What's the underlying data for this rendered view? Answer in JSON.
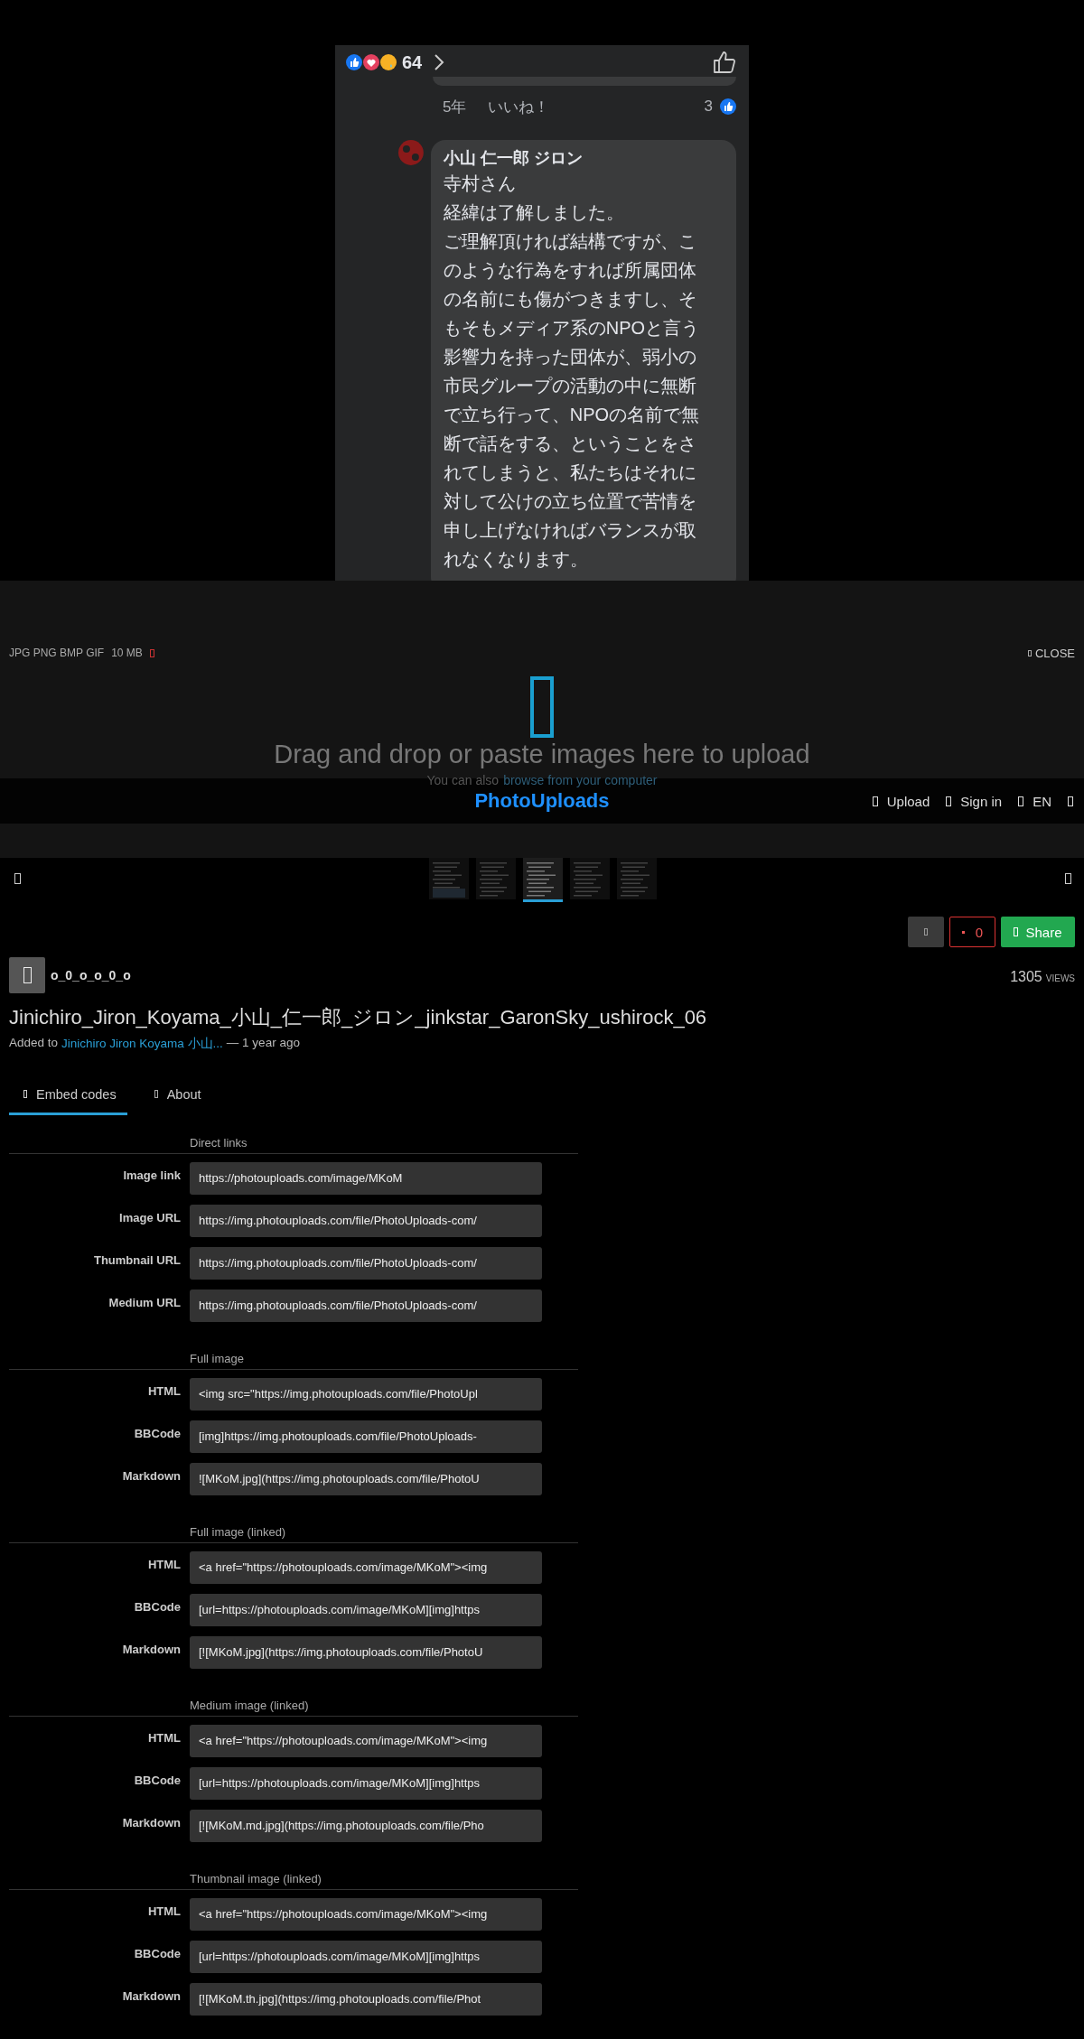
{
  "screenshot": {
    "reaction_count": "64",
    "meta": {
      "age": "5年",
      "like_action": "いいね！",
      "like_count": "3"
    },
    "comment": {
      "author": "小山 仁一郎 ジロン",
      "lines": [
        "寺村さん",
        "経緯は了解しました。",
        "ご理解頂ければ結構ですが、こ",
        "のような行為をすれば所属団体",
        "の名前にも傷がつきますし、そ",
        "もそもメディア系のNPOと言う",
        "影響力を持った団体が、弱小の",
        "市民グループの活動の中に無断",
        "で立ち行って、NPOの名前で無",
        "断で話をする、ということをさ",
        "れてしまうと、私たちはそれに",
        "対して公けの立ち位置で苦情を",
        "申し上げなければバランスが取",
        "れなくなります。"
      ]
    }
  },
  "upload_overlay": {
    "formats": "JPG PNG BMP GIF",
    "max_size": "10 MB",
    "close": "CLOSE",
    "prompt": "Drag and drop or paste images here to upload",
    "hint": "You can also",
    "hint_link": "browse from your computer"
  },
  "header": {
    "logo": "PhotoUploads",
    "nav": [
      "Upload",
      "Sign in",
      "EN"
    ]
  },
  "thumbnails": [
    {
      "selected": false
    },
    {
      "selected": false
    },
    {
      "selected": true
    },
    {
      "selected": false
    },
    {
      "selected": false
    }
  ],
  "actions": {
    "like_count": "0",
    "share": "Share"
  },
  "author": {
    "username": "o_0_o_o_0_o"
  },
  "views": {
    "count": "1305",
    "label": "VIEWS"
  },
  "title": "Jinichiro_Jiron_Koyama_小山_仁一郎_ジロン_jinkstar_GaronSky_ushirock_06",
  "added": {
    "prefix": "Added to",
    "album": "Jinichiro Jiron Koyama 小山...",
    "suffix": "— 1 year ago"
  },
  "tabs": [
    {
      "label": "Embed codes",
      "selected": true
    },
    {
      "label": "About",
      "selected": false
    }
  ],
  "embed_sections": [
    {
      "title": "Direct links",
      "rows": [
        {
          "label": "Image link",
          "value": "https://photouploads.com/image/MKoM"
        },
        {
          "label": "Image URL",
          "value": "https://img.photouploads.com/file/PhotoUploads-com/"
        },
        {
          "label": "Thumbnail URL",
          "value": "https://img.photouploads.com/file/PhotoUploads-com/"
        },
        {
          "label": "Medium URL",
          "value": "https://img.photouploads.com/file/PhotoUploads-com/"
        }
      ]
    },
    {
      "title": "Full image",
      "rows": [
        {
          "label": "HTML",
          "value": "<img src=\"https://img.photouploads.com/file/PhotoUpl"
        },
        {
          "label": "BBCode",
          "value": "[img]https://img.photouploads.com/file/PhotoUploads-"
        },
        {
          "label": "Markdown",
          "value": "![MKoM.jpg](https://img.photouploads.com/file/PhotoU"
        }
      ]
    },
    {
      "title": "Full image (linked)",
      "rows": [
        {
          "label": "HTML",
          "value": "<a href=\"https://photouploads.com/image/MKoM\"><img"
        },
        {
          "label": "BBCode",
          "value": "[url=https://photouploads.com/image/MKoM][img]https"
        },
        {
          "label": "Markdown",
          "value": "[![MKoM.jpg](https://img.photouploads.com/file/PhotoU"
        }
      ]
    },
    {
      "title": "Medium image (linked)",
      "rows": [
        {
          "label": "HTML",
          "value": "<a href=\"https://photouploads.com/image/MKoM\"><img"
        },
        {
          "label": "BBCode",
          "value": "[url=https://photouploads.com/image/MKoM][img]https"
        },
        {
          "label": "Markdown",
          "value": "[![MKoM.md.jpg](https://img.photouploads.com/file/Pho"
        }
      ]
    },
    {
      "title": "Thumbnail image (linked)",
      "rows": [
        {
          "label": "HTML",
          "value": "<a href=\"https://photouploads.com/image/MKoM\"><img"
        },
        {
          "label": "BBCode",
          "value": "[url=https://photouploads.com/image/MKoM][img]https"
        },
        {
          "label": "Markdown",
          "value": "[![MKoM.th.jpg](https://img.photouploads.com/file/Phot"
        }
      ]
    }
  ]
}
